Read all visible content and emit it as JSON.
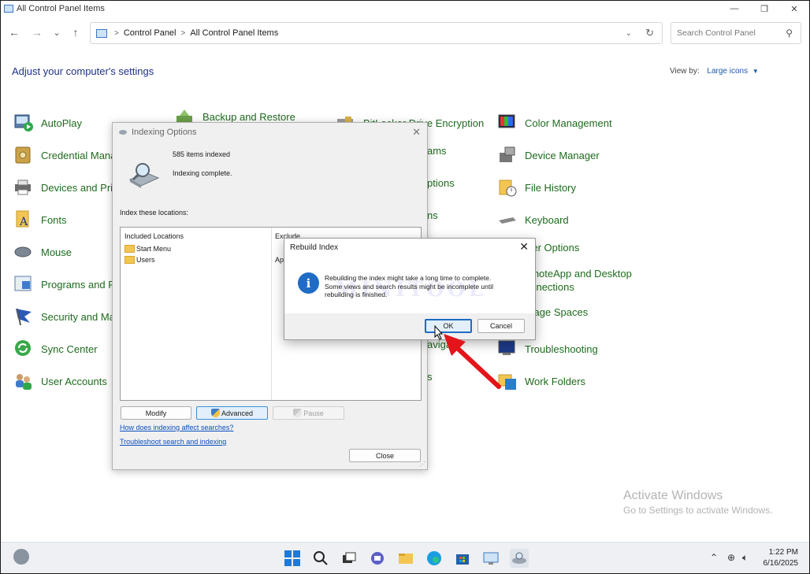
{
  "window": {
    "title": "All Control Panel Items",
    "minimize": "—",
    "maximize": "❐",
    "close": "✕"
  },
  "nav": {
    "back": "←",
    "forward": "→",
    "recent": "⌄",
    "up": "↑",
    "breadcrumb": [
      "Control Panel",
      "All Control Panel Items"
    ],
    "breadcrumb_sep": ">",
    "search_placeholder": "Search Control Panel"
  },
  "header": {
    "title": "Adjust your computer's settings",
    "view_by_label": "View by:",
    "view_by_value": "Large icons"
  },
  "items": {
    "autoplay": "AutoPlay",
    "backup": "Backup and Restore",
    "bitlocker": "BitLocker Drive Encryption",
    "color": "Color Management",
    "credential": "Credential Mana",
    "device_manager": "Device Manager",
    "devices": "Devices and Prin",
    "file_history": "File History",
    "fonts": "Fonts",
    "keyboard": "Keyboard",
    "mouse": "Mouse",
    "power": "wer Options",
    "programs": "Programs and F",
    "remoteapp_1": "emoteApp and Desktop",
    "remoteapp_2": "onnections",
    "security": "Security and Ma",
    "storage": "orage Spaces",
    "sync": "Sync Center",
    "troubleshooting": "Troubleshooting",
    "user_accounts": "User Accounts",
    "work_folders": "Work Folders",
    "partial_ams": "ams",
    "partial_options": "ptions",
    "partial_ns": "ns",
    "partial_navig": "avigat",
    "partial_s": "s"
  },
  "indexing": {
    "title": "Indexing Options",
    "items_indexed": "585 items indexed",
    "status": "Indexing complete.",
    "locations_label": "Index these locations:",
    "col_included": "Included Locations",
    "col_exclude": "Exclude",
    "locations": [
      "Start Menu",
      "Users"
    ],
    "exclude_partial": "App",
    "modify": "Modify",
    "advanced": "Advanced",
    "pause": "Pause",
    "link_how": "How does indexing affect searches?",
    "link_troubleshoot": "Troubleshoot search and indexing",
    "close": "Close"
  },
  "rebuild": {
    "title": "Rebuild Index",
    "message_1": "Rebuilding the index might take a long time to complete.",
    "message_2": "Some views and search results might be incomplete until",
    "message_3": "rebuilding is finished.",
    "ok": "OK",
    "cancel": "Cancel"
  },
  "activate": {
    "line1": "Activate Windows",
    "line2": "Go to Settings to activate Windows."
  },
  "tray": {
    "time": "1:22 PM",
    "date": "6/16/2025"
  },
  "colors": {
    "link_green": "#1e6b1e",
    "heading_blue": "#1e3287",
    "accent": "#1f6cc5",
    "pointer_red": "#e3151a"
  }
}
